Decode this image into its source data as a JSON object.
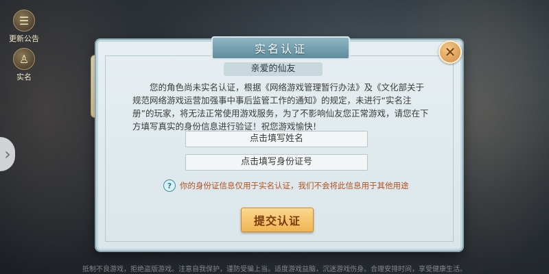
{
  "side": {
    "announcement_label": "更新公告",
    "realname_label": "实名"
  },
  "dialog": {
    "title": "实名认证",
    "subtitle": "亲爱的仙友",
    "notice": "您的角色尚未实名认证，根据《网络游戏管理暂行办法》及《文化部关于规范网络游戏运营加强事中事后监管工作的通知》的规定，未进行“实名注册”的玩家，将无法正常使用游戏服务，为了不影响仙友您正常游戏，请您在下方填写真实的身份信息进行验证！祝您游戏愉快！",
    "name_field": "点击填写姓名",
    "id_field": "点击填写身份证号",
    "hint_icon": "?",
    "hint_text": "你的身份证信息仅用于实名认证，我们不会将此信息用于其他用途",
    "submit_label": "提交认证",
    "close_icon": "✕"
  },
  "footer": "抵制不良游戏，拒绝盗版游戏。注意自我保护，谨防受骗上当。适度游戏益脑，沉迷游戏伤身。合理安排时间，享受健康生活。",
  "colors": {
    "accent": "#efb452",
    "title_plaque": "#5f8c9c",
    "hint_text": "#b0521f"
  }
}
